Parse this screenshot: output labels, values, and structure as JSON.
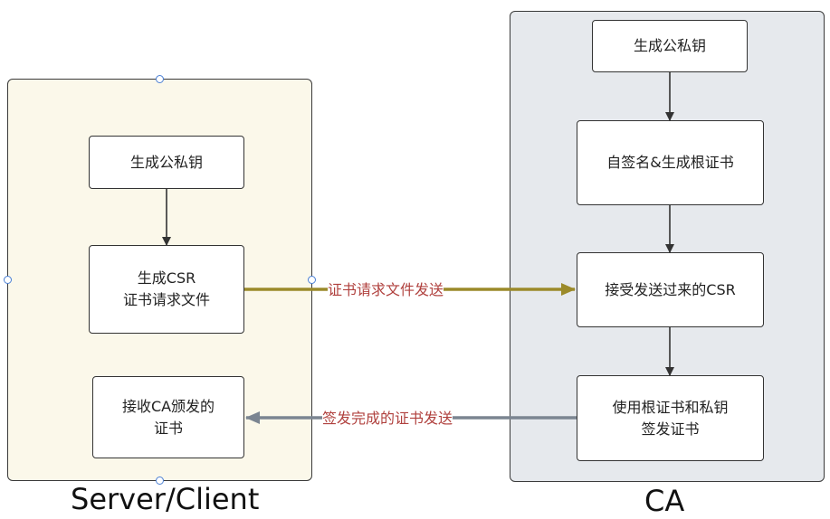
{
  "lanes": {
    "left_title": "Server/Client",
    "right_title": "CA"
  },
  "left_nodes": {
    "gen_keys": "生成公私钥",
    "gen_csr_line1": "生成CSR",
    "gen_csr_line2": "证书请求文件",
    "receive_line1": "接收CA颁发的",
    "receive_line2": "证书"
  },
  "right_nodes": {
    "gen_keys": "生成公私钥",
    "self_sign": "自签名&生成根证书",
    "accept_csr": "接受发送过来的CSR",
    "issue_line1": "使用根证书和私钥",
    "issue_line2": "签发证书"
  },
  "edges": {
    "csr_send_label": "证书请求文件发送",
    "cert_send_label": "签发完成的证书发送"
  },
  "colors": {
    "csr_arrow": "#9b8a2a",
    "cert_arrow": "#7b8591",
    "edge_text": "#b0413e",
    "left_lane_fill": "#fbf8ea",
    "right_lane_fill": "#e6e9ed",
    "handle": "#4a7fd4"
  }
}
